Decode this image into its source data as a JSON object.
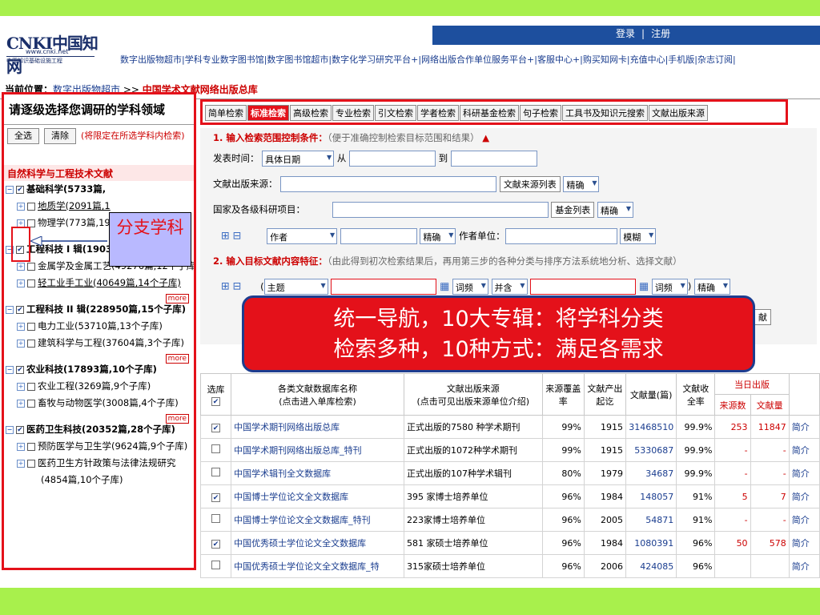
{
  "header": {
    "login": "登录",
    "sep": "|",
    "register": "注册",
    "logo_main": "CNKI中国知网",
    "logo_url": "www.cnki.net",
    "logo_cn": "中国知识基础设施工程",
    "links": "数字出版物超市|学科专业数字图书馆|数字图书馆超市|数字化学习研究平台+|网络出版合作单位服务平台+|客服中心+|购买知网卡|充值中心|手机版|杂志订阅|"
  },
  "breadcrumb": {
    "label": "当前位置：",
    "link": "数字出版物超市",
    "sep": ">>",
    "current": "中国学术文献网络出版总库"
  },
  "sidebar": {
    "title": "请逐级选择您调研的学科领域",
    "select_all": "全选",
    "clear": "清除",
    "hint": "(将限定在所选学科内检索)",
    "section": "自然科学与工程技术文献",
    "more": "more",
    "nodes": [
      "基础科学(5733篇,",
      "地质学(2091篇,1",
      "物理学(773篇,19",
      "工程科技 I 辑(190304篇,14个子库)",
      "金属学及金属工艺(49276篇,12个子库)",
      "轻工业手工业(40649篇,14个子库)",
      "工程科技 II 辑(228950篇,15个子库)",
      "电力工业(53710篇,13个子库)",
      "建筑科学与工程(37604篇,3个子库)",
      "农业科技(17893篇,10个子库)",
      "农业工程(3269篇,9个子库)",
      "畜牧与动物医学(3008篇,4个子库)",
      "医药卫生科技(20352篇,28个子库)",
      "预防医学与卫生学(9624篇,9个子库)",
      "医药卫生方针政策与法律法规研究",
      "(4854篇,10个子库)"
    ]
  },
  "branch_label": "分支学科",
  "tabs": [
    "简单检索",
    "标准检索",
    "高级检索",
    "专业检索",
    "引文检索",
    "学者检索",
    "科研基金检索",
    "句子检索",
    "工具书及知识元搜索",
    "文献出版来源"
  ],
  "form": {
    "step1": "1. 输入检索范围控制条件：",
    "step1_hint": "（便于准确控制检索目标范围和结果）",
    "date_label": "发表时间：",
    "date_opt": "具体日期",
    "from": "从",
    "to": "到",
    "source_label": "文献出版来源：",
    "source_btn": "文献来源列表",
    "exact": "精确",
    "fund_label": "国家及各级科研项目：",
    "fund_btn": "基金列表",
    "author": "作者",
    "author_unit": "作者单位：",
    "fuzzy": "模糊",
    "step2": "2. 输入目标文献内容特征：",
    "step2_hint": "（由此得到初次检索结果后，再用第三步的各种分类与排序方法系统地分析、选择文献）",
    "topic": "主题",
    "freq": "词频",
    "and": "并含",
    "search_btn": "献"
  },
  "callout": {
    "line1": "统一导航，10大专辑：将学科分类",
    "line2": "检索多种，10种方式：满足各需求"
  },
  "table": {
    "headers": [
      "选库",
      "各类文献数据库名称",
      "文献出版来源",
      "来源覆盖率",
      "文献产出起讫",
      "文献量(篇)",
      "文献收全率",
      "当日出版",
      "来源数",
      "文献量"
    ],
    "sub1": "(点击进入单库检索)",
    "sub2": "(点击可见出版来源单位介绍)",
    "rows": [
      {
        "checked": "✔",
        "name": "中国学术期刊网络出版总库",
        "src": "正式出版的7580 种学术期刊",
        "cov": "99%",
        "year": "1915",
        "count": "31468510",
        "rate": "99.9%",
        "dsrc": "253",
        "dcount": "11847",
        "intro": "简介"
      },
      {
        "checked": "",
        "name": "中国学术期刊网络出版总库_特刊",
        "src": "正式出版的1072种学术期刊",
        "cov": "99%",
        "year": "1915",
        "count": "5330687",
        "rate": "99.9%",
        "dsrc": "-",
        "dcount": "-",
        "intro": "简介"
      },
      {
        "checked": "",
        "name": "中国学术辑刊全文数据库",
        "src": "正式出版的107种学术辑刊",
        "cov": "80%",
        "year": "1979",
        "count": "34687",
        "rate": "99.9%",
        "dsrc": "-",
        "dcount": "-",
        "intro": "简介"
      },
      {
        "checked": "✔",
        "name": "中国博士学位论文全文数据库",
        "src": "395 家博士培养单位",
        "cov": "96%",
        "year": "1984",
        "count": "148057",
        "rate": "91%",
        "dsrc": "5",
        "dcount": "7",
        "intro": "简介"
      },
      {
        "checked": "",
        "name": "中国博士学位论文全文数据库_特刊",
        "src": "223家博士培养单位",
        "cov": "96%",
        "year": "2005",
        "count": "54871",
        "rate": "91%",
        "dsrc": "-",
        "dcount": "-",
        "intro": "简介"
      },
      {
        "checked": "✔",
        "name": "中国优秀硕士学位论文全文数据库",
        "src": "581 家硕士培养单位",
        "cov": "96%",
        "year": "1984",
        "count": "1080391",
        "rate": "96%",
        "dsrc": "50",
        "dcount": "578",
        "intro": "简介"
      },
      {
        "checked": "",
        "name": "中国优秀硕士学位论文全文数据库_特",
        "src": "315家硕士培养单位",
        "cov": "96%",
        "year": "2006",
        "count": "424085",
        "rate": "96%",
        "dsrc": "",
        "dcount": "",
        "intro": "简介"
      }
    ]
  }
}
